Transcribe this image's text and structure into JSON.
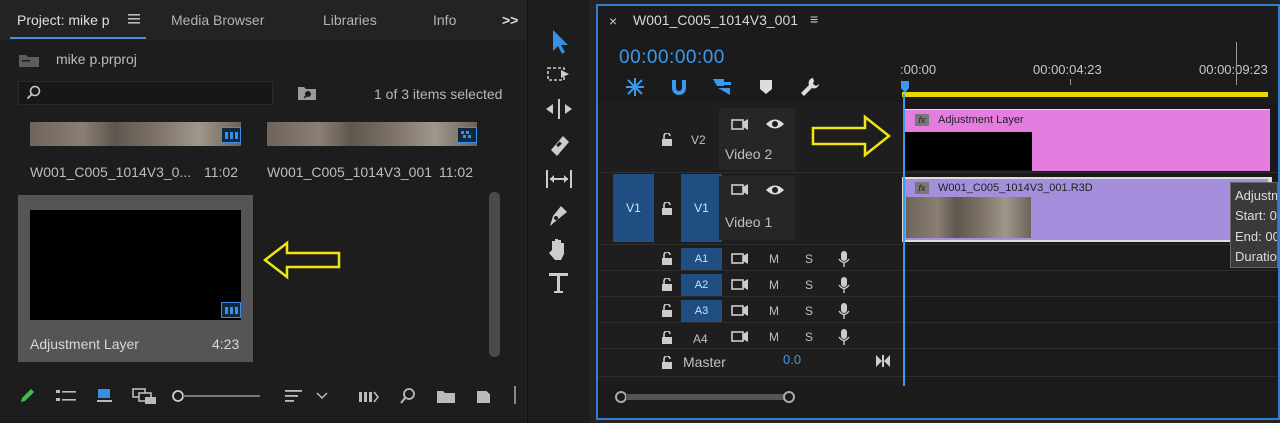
{
  "project_panel": {
    "tabs": [
      {
        "label": "Project: mike p",
        "active": true
      },
      {
        "label": "Media Browser"
      },
      {
        "label": "Libraries"
      },
      {
        "label": "Info"
      }
    ],
    "tab_menu_icon": "hamburger-icon",
    "overflow_icon": ">>",
    "project_file": "mike p.prproj",
    "search_placeholder": "",
    "selection_status": "1 of 3 items selected",
    "items": [
      {
        "name": "W001_C005_1014V3_0...",
        "duration": "11:02"
      },
      {
        "name": "W001_C005_1014V3_001",
        "duration": "11:02"
      },
      {
        "name": "Adjustment Layer",
        "duration": "4:23",
        "selected": true
      }
    ]
  },
  "sequence": {
    "tab_title": "W001_C005_1014V3_001",
    "close_glyph": "×",
    "menu_glyph": "≡",
    "timecode": "00:00:00:00",
    "ruler": [
      ":00:00",
      "00:00:04:23",
      "00:00:09:23"
    ],
    "tracks": {
      "v2": {
        "target": "V2",
        "name": "Video 2"
      },
      "v1": {
        "source": "V1",
        "target": "V1",
        "name": "Video 1"
      },
      "audio": [
        {
          "target": "A1",
          "m": "M",
          "s": "S"
        },
        {
          "target": "A2",
          "m": "M",
          "s": "S"
        },
        {
          "target": "A3",
          "m": "M",
          "s": "S"
        },
        {
          "target": "A4",
          "m": "M",
          "s": "S"
        }
      ],
      "master": {
        "label": "Master",
        "value": "0.0"
      }
    },
    "clips": {
      "adjustment": {
        "fx": "fx",
        "name": "Adjustment Layer",
        "color": "#e37ee0"
      },
      "video": {
        "fx": "fx",
        "name": "W001_C005_1014V3_001.R3D",
        "color": "#a58fdd"
      }
    },
    "tooltip": [
      "Adjustm",
      "Start: 0",
      "End: 00",
      "Duratio"
    ]
  },
  "colors": {
    "accent": "#2f7fd4",
    "annotation_arrow": "#f2e516",
    "in_out_bar": "#e8d800"
  }
}
